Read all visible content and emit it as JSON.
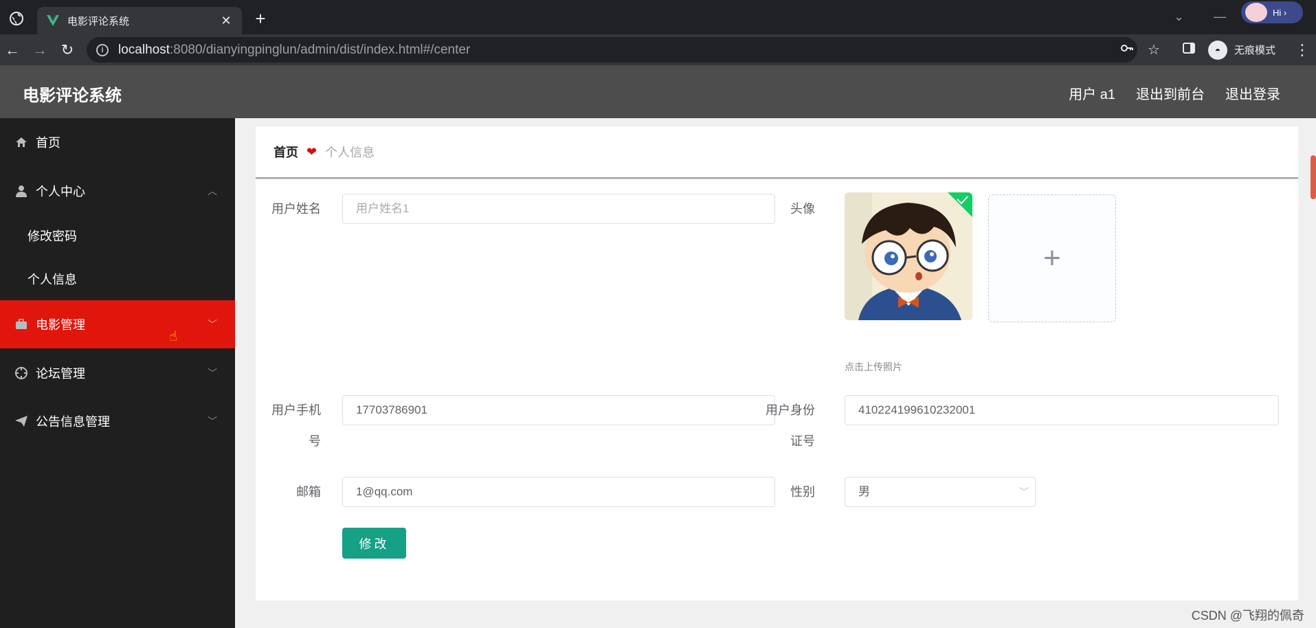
{
  "browser": {
    "tab_title": "电影评论系统",
    "url_host": "localhost",
    "url_rest": ":8080/dianyingpinglun/admin/dist/index.html#/center",
    "incognito_label": "无痕模式",
    "profile_badge": "Hi ›"
  },
  "header": {
    "app_title": "电影评论系统",
    "user_label": "用户 a1",
    "back_to_front": "退出到前台",
    "logout": "退出登录"
  },
  "sidebar": {
    "items": [
      {
        "label": "首页",
        "icon": "home-icon"
      },
      {
        "label": "个人中心",
        "icon": "user-icon"
      },
      {
        "label": "修改密码"
      },
      {
        "label": "个人信息"
      },
      {
        "label": "电影管理",
        "icon": "briefcase-icon",
        "active": true
      },
      {
        "label": "论坛管理",
        "icon": "crosshair-icon"
      },
      {
        "label": "公告信息管理",
        "icon": "send-icon"
      }
    ],
    "active_color": "#e0150c"
  },
  "breadcrumb": {
    "home": "首页",
    "current": "个人信息"
  },
  "form": {
    "username_label": "用户姓名",
    "username_placeholder": "用户姓名1",
    "avatar_label": "头像",
    "upload_tip": "点击上传照片",
    "phone_label_line1": "用户手机",
    "phone_label_line2": "号",
    "phone_value": "17703786901",
    "idcard_label_line1": "用户身份",
    "idcard_label_line2": "证号",
    "idcard_value": "410224199610232001",
    "email_label": "邮箱",
    "email_value": "1@qq.com",
    "gender_label": "性别",
    "gender_value": "男",
    "submit_label": "修改",
    "submit_color": "#16a086"
  },
  "watermark": "CSDN @飞翔的佩奇"
}
